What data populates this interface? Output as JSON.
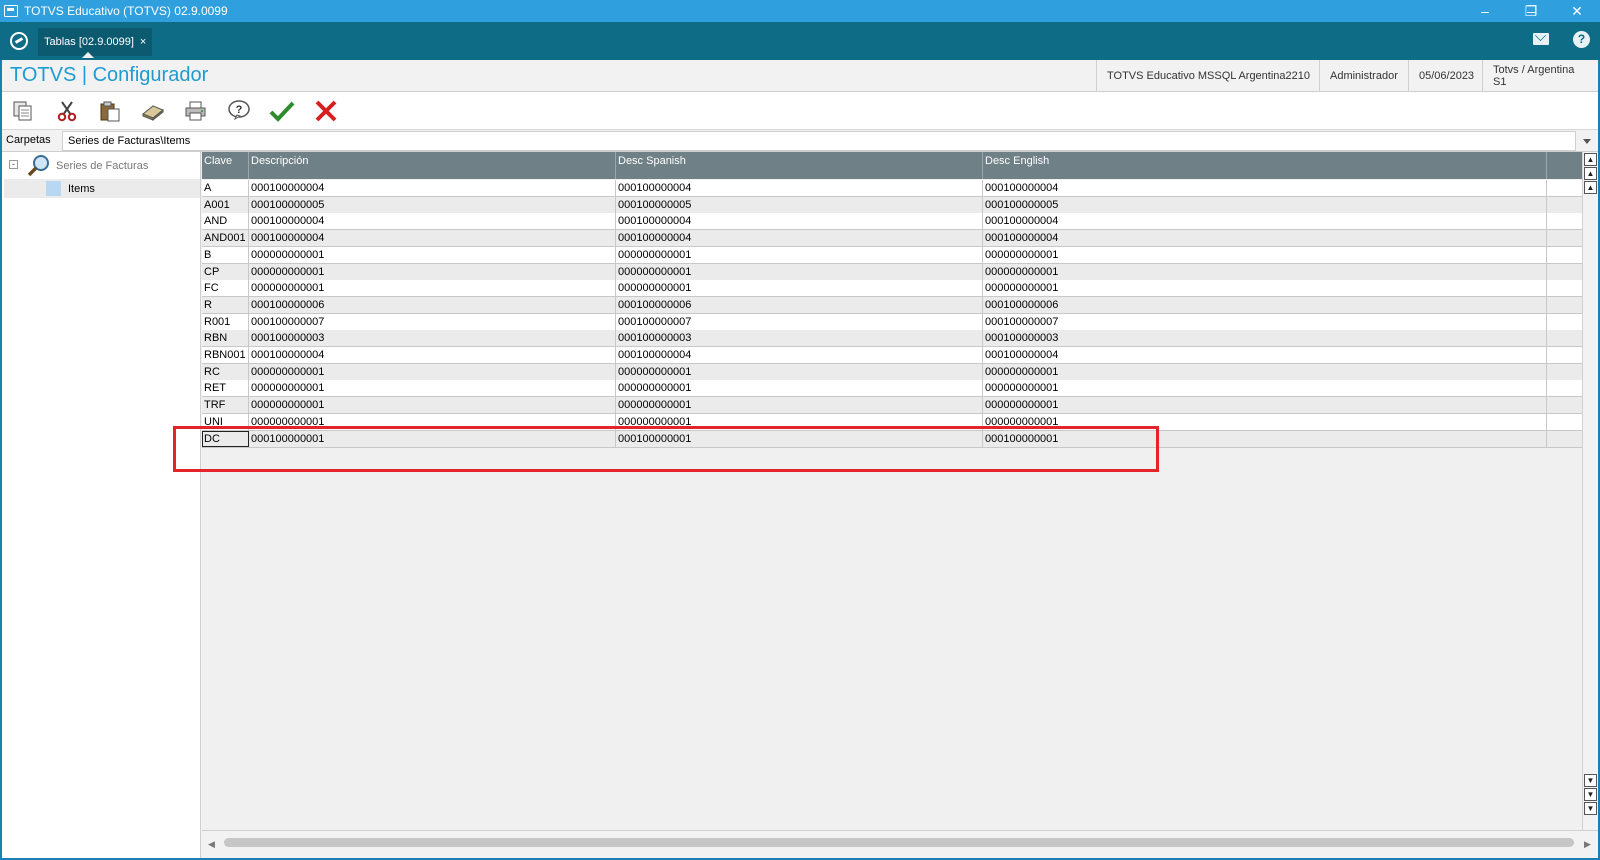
{
  "window": {
    "title": "TOTVS Educativo (TOTVS) 02.9.0099"
  },
  "tab": {
    "label": "Tablas [02.9.0099]",
    "close": "×"
  },
  "header": {
    "title": "TOTVS | Configurador",
    "environment": "TOTVS Educativo MSSQL Argentina2210",
    "user": "Administrador",
    "date": "05/06/2023",
    "company": "Totvs / Argentina S1"
  },
  "toolbar": {
    "icons": [
      "copy-icon",
      "cut-icon",
      "paste-icon",
      "eraser-icon",
      "print-icon",
      "help-icon",
      "confirm-icon",
      "cancel-icon"
    ]
  },
  "pathbar": {
    "label": "Carpetas",
    "path": "Series de Facturas\\Items"
  },
  "tree": {
    "root": "Series de Facturas",
    "child": "Items"
  },
  "table": {
    "columns": [
      "Clave",
      "Descripción",
      "Desc Spanish",
      "Desc English"
    ],
    "rows": [
      [
        "A",
        "000100000004",
        "000100000004",
        "000100000004"
      ],
      [
        "A001",
        "000100000005",
        "000100000005",
        "000100000005"
      ],
      [
        "AND",
        "000100000004",
        "000100000004",
        "000100000004"
      ],
      [
        "AND001",
        "000100000004",
        "000100000004",
        "000100000004"
      ],
      [
        "B",
        "000000000001",
        "000000000001",
        "000000000001"
      ],
      [
        "CP",
        "000000000001",
        "000000000001",
        "000000000001"
      ],
      [
        "FC",
        "000000000001",
        "000000000001",
        "000000000001"
      ],
      [
        "R",
        "000100000006",
        "000100000006",
        "000100000006"
      ],
      [
        "R001",
        "000100000007",
        "000100000007",
        "000100000007"
      ],
      [
        "RBN",
        "000100000003",
        "000100000003",
        "000100000003"
      ],
      [
        "RBN001",
        "000100000004",
        "000100000004",
        "000100000004"
      ],
      [
        "RC",
        "000000000001",
        "000000000001",
        "000000000001"
      ],
      [
        "RET",
        "000000000001",
        "000000000001",
        "000000000001"
      ],
      [
        "TRF",
        "000000000001",
        "000000000001",
        "000000000001"
      ],
      [
        "UNI",
        "000000000001",
        "000000000001",
        "000000000001"
      ],
      [
        "DC",
        "000100000001",
        "000100000001",
        "000100000001"
      ]
    ],
    "focused_row": 15
  },
  "colors": {
    "accent": "#1e9bd0",
    "tabbar": "#0f6c86",
    "titlebar": "#2f9fde",
    "grid_header": "#6f8086",
    "highlight": "#e3242b"
  }
}
